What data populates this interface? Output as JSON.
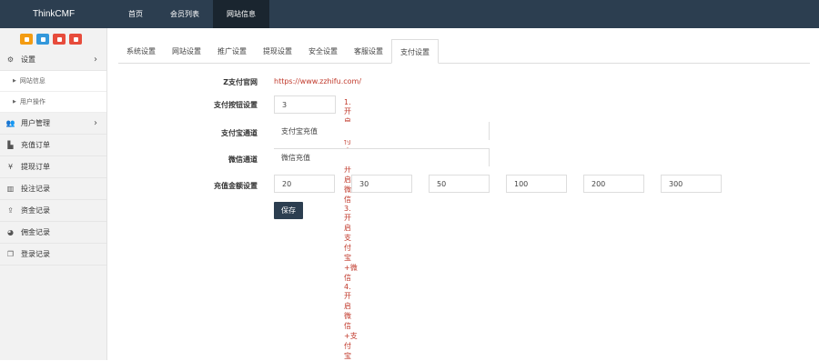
{
  "brand": "ThinkCMF",
  "topnav": [
    "首页",
    "会员列表",
    "网站信息"
  ],
  "quick_buttons": [
    {
      "color": "#f39c12"
    },
    {
      "color": "#3498db"
    },
    {
      "color": "#e74c3c"
    },
    {
      "color": "#e74c3c"
    }
  ],
  "sidebar": {
    "settings": "设置",
    "sub_items": [
      "网站信息",
      "用户操作"
    ],
    "items": [
      "用户管理",
      "充值订单",
      "提现订单",
      "投注记录",
      "资金记录",
      "佣金记录",
      "登录记录"
    ]
  },
  "tabs": [
    "系统设置",
    "网站设置",
    "推广设置",
    "提现设置",
    "安全设置",
    "客服设置",
    "支付设置"
  ],
  "form": {
    "z_pay_label": "Z支付官网",
    "z_pay_link": "https://www.zzhifu.com/",
    "switch_label": "支付按钮设置",
    "switch_value": "3",
    "switch_hint": "1.开启支付宝 2.开启微信 3.开启支付宝+微信 4.开启微信+支付宝",
    "alipay_label": "支付宝通道",
    "alipay_value": "支付宝充值",
    "wechat_label": "微信通道",
    "wechat_value": "微信充值",
    "amount_label": "充值金额设置",
    "amounts": [
      "20",
      "30",
      "50",
      "100",
      "200",
      "300"
    ],
    "save": "保存"
  }
}
